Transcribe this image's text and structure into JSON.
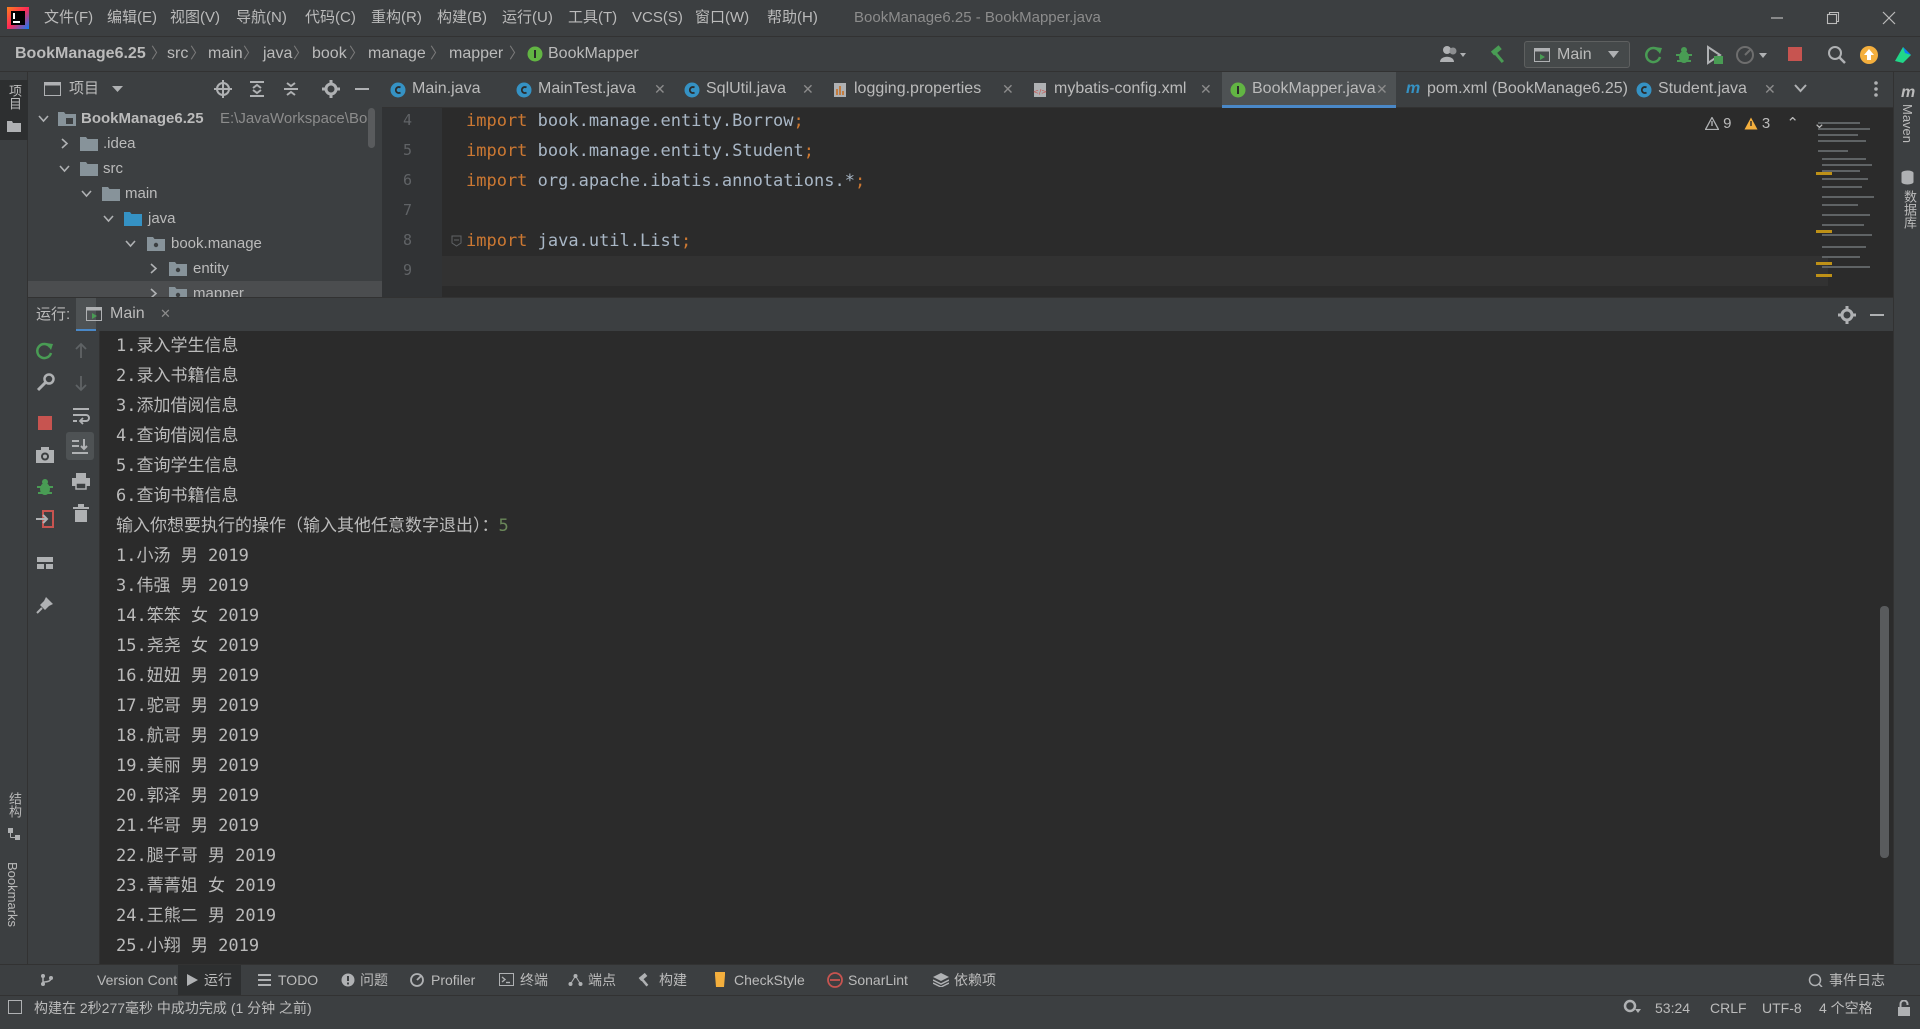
{
  "menu": [
    "文件(F)",
    "编辑(E)",
    "视图(V)",
    "导航(N)",
    "代码(C)",
    "重构(R)",
    "构建(B)",
    "运行(U)",
    "工具(T)",
    "VCS(S)",
    "窗口(W)",
    "帮助(H)"
  ],
  "window_title": "BookManage6.25 - BookMapper.java",
  "breadcrumb": [
    "BookManage6.25",
    "src",
    "main",
    "java",
    "book",
    "manage",
    "mapper",
    "BookMapper"
  ],
  "run_config": "Main",
  "project_panel": {
    "title": "项目",
    "tree": [
      {
        "label": "BookManage6.25",
        "path": "E:\\JavaWorkspace\\Boo"
      },
      {
        "label": ".idea"
      },
      {
        "label": "src"
      },
      {
        "label": "main"
      },
      {
        "label": "java"
      },
      {
        "label": "book.manage"
      },
      {
        "label": "entity"
      },
      {
        "label": "mapper"
      }
    ]
  },
  "editor_tabs": [
    {
      "label": "Main.java"
    },
    {
      "label": "MainTest.java"
    },
    {
      "label": "SqlUtil.java"
    },
    {
      "label": "logging.properties"
    },
    {
      "label": "mybatis-config.xml"
    },
    {
      "label": "BookMapper.java"
    },
    {
      "label": "pom.xml (BookManage6.25)"
    },
    {
      "label": "Student.java"
    }
  ],
  "editor": {
    "lines": [
      {
        "no": "4",
        "kw": "import",
        "text": " book.manage.entity.Borrow",
        "semi": ";"
      },
      {
        "no": "5",
        "kw": "import",
        "text": " book.manage.entity.Student",
        "semi": ";"
      },
      {
        "no": "6",
        "kw": "import",
        "text": " org.apache.ibatis.annotations.*",
        "semi": ";"
      },
      {
        "no": "7",
        "kw": "",
        "text": "",
        "semi": ""
      },
      {
        "no": "8",
        "kw": "import",
        "text": " java.util.List",
        "semi": ";"
      },
      {
        "no": "9",
        "kw": "",
        "text": "",
        "semi": ""
      }
    ],
    "warnings": "9",
    "weak_warnings": "3"
  },
  "run_window": {
    "label": "运行:",
    "tab": "Main"
  },
  "console": [
    {
      "text": "1.录入学生信息"
    },
    {
      "text": "2.录入书籍信息"
    },
    {
      "text": "3.添加借阅信息"
    },
    {
      "text": "4.查询借阅信息"
    },
    {
      "text": "5.查询学生信息"
    },
    {
      "text": "6.查询书籍信息"
    },
    {
      "text": "输入你想要执行的操作（输入其他任意数字退出）：",
      "input": "5"
    },
    {
      "text": "1.小汤 男 2019"
    },
    {
      "text": "3.伟强 男 2019"
    },
    {
      "text": "14.笨笨 女 2019"
    },
    {
      "text": "15.尧尧 女 2019"
    },
    {
      "text": "16.妞妞 男 2019"
    },
    {
      "text": "17.驼哥 男 2019"
    },
    {
      "text": "18.航哥 男 2019"
    },
    {
      "text": "19.美丽 男 2019"
    },
    {
      "text": "20.郭泽 男 2019"
    },
    {
      "text": "21.华哥 男 2019"
    },
    {
      "text": "22.腿子哥 男 2019"
    },
    {
      "text": "23.菁菁姐 女 2019"
    },
    {
      "text": "24.王熊二 男 2019"
    },
    {
      "text": "25.小翔 男 2019"
    }
  ],
  "left_stripe": {
    "project": "项目",
    "structure": "结构",
    "bookmarks": "Bookmarks"
  },
  "right_stripe": {
    "maven": "Maven",
    "database": "数据库"
  },
  "bottom_tools": [
    "Version Control",
    "运行",
    "TODO",
    "问题",
    "Profiler",
    "终端",
    "端点",
    "构建",
    "CheckStyle",
    "SonarLint",
    "依赖项"
  ],
  "event_log": "事件日志",
  "status": {
    "message": "构建在 2秒277毫秒 中成功完成 (1 分钟 之前)",
    "position": "53:24",
    "line_sep": "CRLF",
    "encoding": "UTF-8",
    "indent": "4 个空格"
  },
  "colors": {
    "accent": "#4a88c7",
    "keyword": "#cc7832",
    "input": "#6a8759",
    "background": "#2b2b2b",
    "panel": "#3c3f41"
  }
}
